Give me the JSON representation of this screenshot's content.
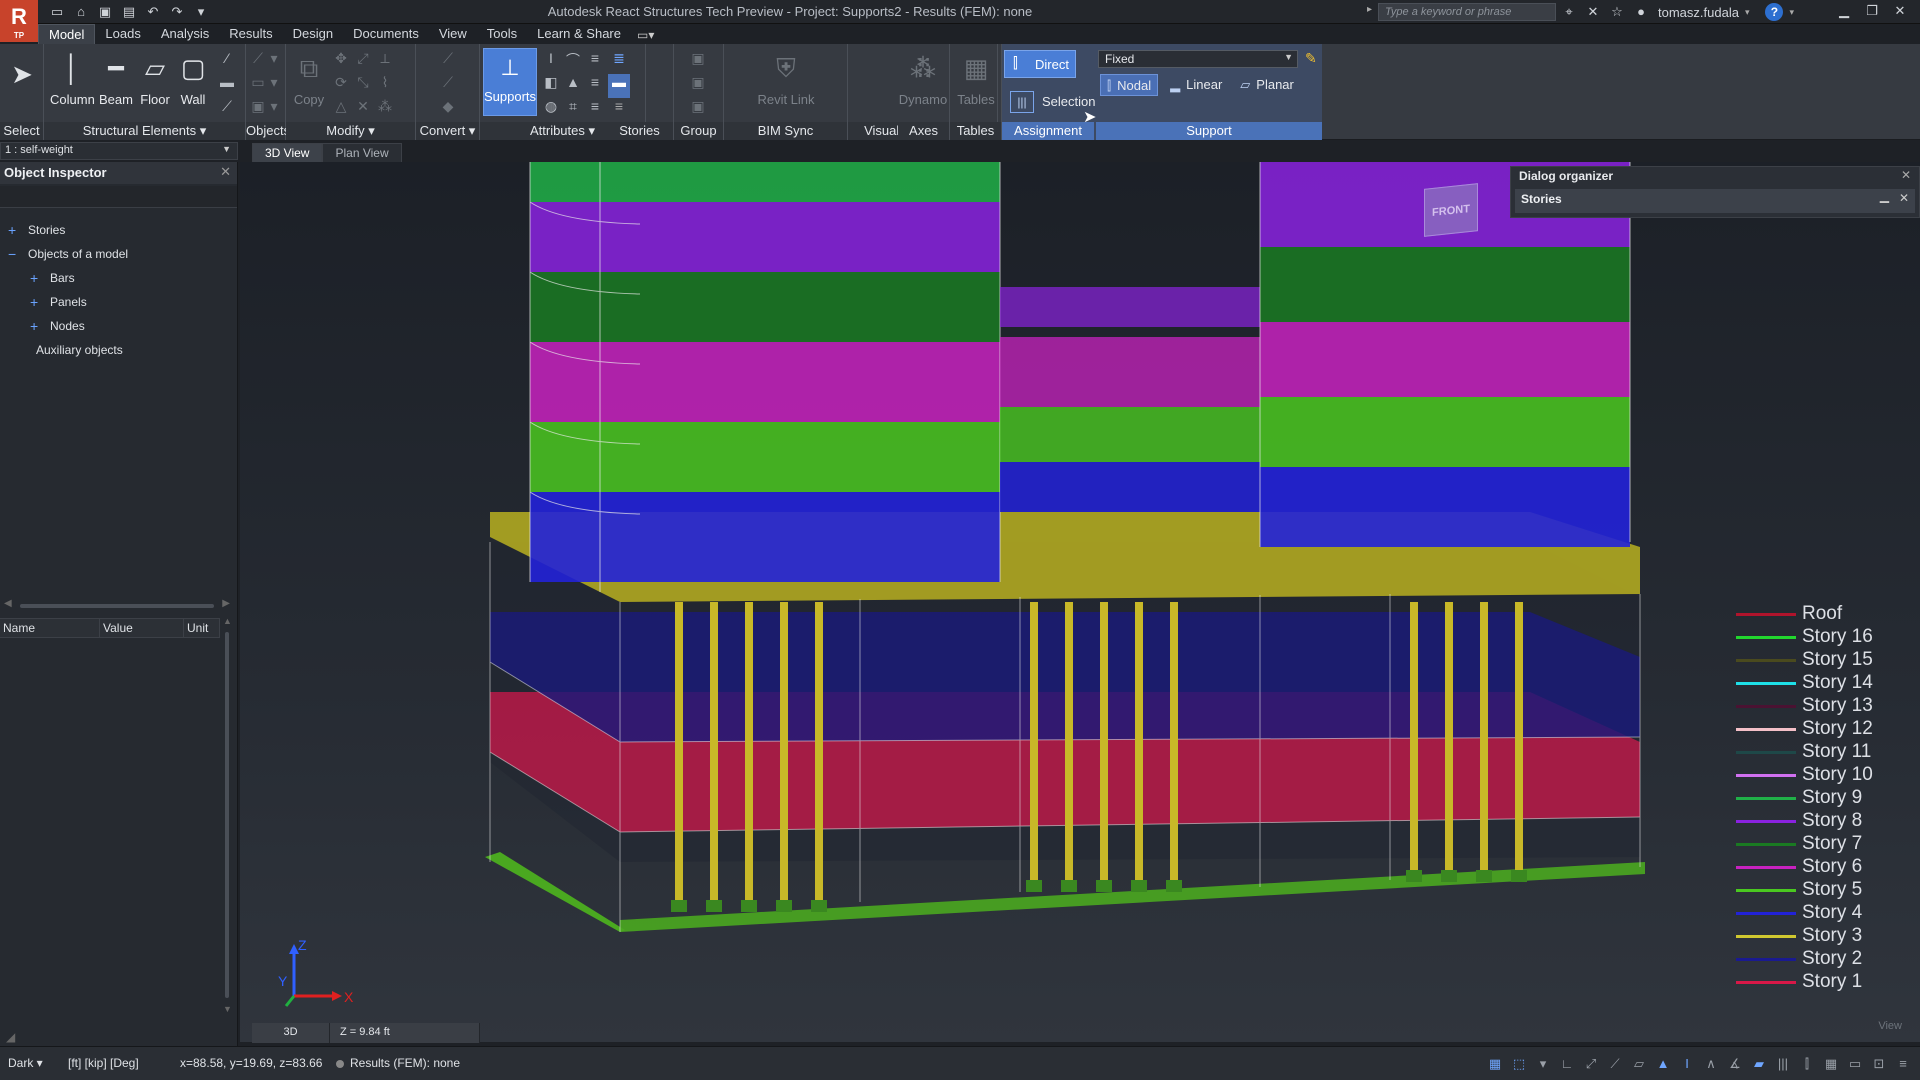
{
  "window": {
    "title": "Autodesk React Structures Tech Preview - Project: Supports2 - Results (FEM): none",
    "logo_text": "R",
    "logo_sub": "TP",
    "search_placeholder": "Type a keyword or phrase",
    "user_name": "tomasz.fudala"
  },
  "ribbon_tabs": [
    "Model",
    "Loads",
    "Analysis",
    "Results",
    "Design",
    "Documents",
    "View",
    "Tools",
    "Learn & Share"
  ],
  "ribbon": {
    "select_label": "Select",
    "structural_elements": {
      "title": "Structural Elements",
      "column": "Column",
      "beam": "Beam",
      "floor": "Floor",
      "wall": "Wall"
    },
    "objects_title": "Objects",
    "modify_title": "Modify",
    "copy_label": "Copy",
    "convert_title": "Convert",
    "attributes_title": "Attributes",
    "supports_label": "Supports",
    "stories_title": "Stories",
    "group_title": "Group",
    "bim_sync": {
      "title": "BIM Sync",
      "revit_link": "Revit Link"
    },
    "visual_programming": {
      "title": "Visual Programming",
      "dynamo": "Dynamo"
    },
    "axes_title": "Axes",
    "tables": {
      "title": "Tables",
      "label": "Tables"
    },
    "assignment": {
      "title": "Assignment",
      "direct": "Direct",
      "selection": "Selection"
    },
    "support": {
      "title": "Support",
      "type_value": "Fixed",
      "nodal": "Nodal",
      "linear": "Linear",
      "planar": "Planar"
    }
  },
  "loadcase": "1 : self-weight",
  "view_tabs": [
    "3D View",
    "Plan View"
  ],
  "object_inspector": {
    "title": "Object Inspector",
    "tree": [
      {
        "label": "Stories",
        "expander": "+",
        "indent": 0
      },
      {
        "label": "Objects of a model",
        "expander": "−",
        "indent": 0
      },
      {
        "label": "Bars",
        "expander": "+",
        "indent": 1
      },
      {
        "label": "Panels",
        "expander": "+",
        "indent": 1
      },
      {
        "label": "Nodes",
        "expander": "+",
        "indent": 1
      },
      {
        "label": "Auxiliary objects",
        "expander": "",
        "indent": 1
      }
    ],
    "columns": [
      "Name",
      "Value",
      "Unit"
    ]
  },
  "dialog_organizer": {
    "title": "Dialog organizer",
    "panel": "Stories"
  },
  "view_cube_label": "FRONT",
  "legend": [
    {
      "label": "Roof",
      "color": "#b0142c"
    },
    {
      "label": "Story 16",
      "color": "#22d62e"
    },
    {
      "label": "Story 15",
      "color": "#4a4a1e"
    },
    {
      "label": "Story 14",
      "color": "#1ee0e8"
    },
    {
      "label": "Story 13",
      "color": "#4a1232"
    },
    {
      "label": "Story 12",
      "color": "#f4c0c8"
    },
    {
      "label": "Story 11",
      "color": "#1e4848"
    },
    {
      "label": "Story 10",
      "color": "#d070f0"
    },
    {
      "label": "Story 9",
      "color": "#20b048"
    },
    {
      "label": "Story 8",
      "color": "#8a22e0"
    },
    {
      "label": "Story 7",
      "color": "#1a7a22"
    },
    {
      "label": "Story 6",
      "color": "#c822c0"
    },
    {
      "label": "Story 5",
      "color": "#4ac820"
    },
    {
      "label": "Story 4",
      "color": "#2222d8"
    },
    {
      "label": "Story 3",
      "color": "#d0c830"
    },
    {
      "label": "Story 2",
      "color": "#1a1a90"
    },
    {
      "label": "Story 1",
      "color": "#d81848"
    }
  ],
  "axes": {
    "x": "X",
    "y": "Y",
    "z": "Z"
  },
  "viewport_status": {
    "mode": "3D",
    "z_level": "Z = 9.84 ft"
  },
  "viewport_corner_label": "View",
  "statusbar": {
    "theme": "Dark",
    "units": "[ft] [kip] [Deg]",
    "coords": "x=88.58, y=19.69, z=83.66",
    "results": "Results (FEM): none"
  },
  "colors": {
    "accent": "#4a7ed6",
    "story_bands": [
      "#d81848",
      "#1a1a90",
      "#c8c020",
      "#2222d8",
      "#4ac820",
      "#c822c0",
      "#1a7a22",
      "#8a22e0",
      "#20b048"
    ]
  }
}
